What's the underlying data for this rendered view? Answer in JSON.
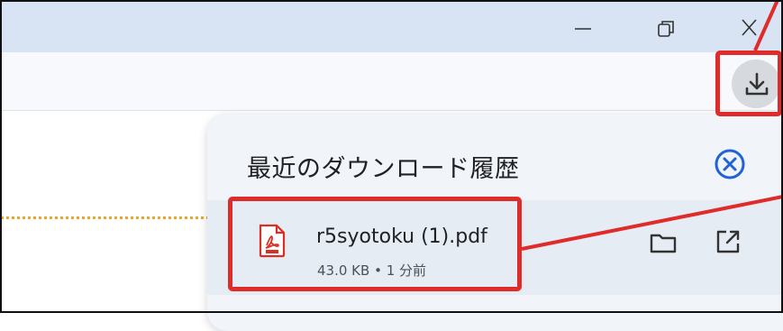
{
  "window_controls": {
    "minimize_icon": "minimize-icon",
    "restore_icon": "restore-icon",
    "close_icon": "close-icon"
  },
  "toolbar": {
    "downloads_icon": "download-icon"
  },
  "downloads_panel": {
    "title": "最近のダウンロード履歴",
    "close_icon": "circle-x-icon",
    "items": [
      {
        "file_name": "r5syotoku (1).pdf",
        "size": "43.0 KB",
        "separator": "•",
        "time": "1 分前",
        "file_type_icon": "pdf-icon",
        "actions": [
          "folder-icon",
          "open-external-icon"
        ]
      }
    ]
  },
  "annotation": {
    "highlight_color": "#e02b2b",
    "highlights": [
      "download-button-highlight",
      "download-item-highlight"
    ]
  },
  "colors": {
    "titlebar": "#d8e4f3",
    "toolbar": "#f7f9fc",
    "panel": "#f1f4f8",
    "item_row": "#e6ecf3",
    "accent_blue": "#1f63d9",
    "pdf_red": "#d93025",
    "dotted_orange": "#f0a22a"
  }
}
